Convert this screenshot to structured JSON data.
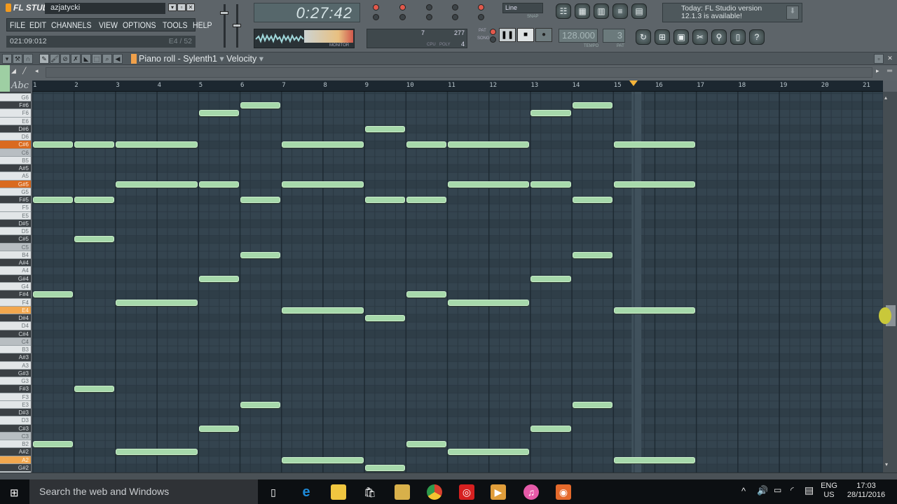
{
  "app": {
    "logo": "FL STUDIO",
    "project": "azjatycki"
  },
  "menu": [
    "FILE",
    "EDIT",
    "CHANNELS",
    "VIEW",
    "OPTIONS",
    "TOOLS",
    "HELP"
  ],
  "hint": {
    "position": "021:09:012",
    "note": "E4 / 52"
  },
  "transport": {
    "time": "0:27:42",
    "tempo": "128.000",
    "tempo_label": "TEMPO",
    "pattern": "3",
    "pattern_label": "PAT",
    "pat_label": "PAT",
    "song_label": "SONG",
    "snap": "Line",
    "snap_label": "SNAP",
    "cpu_label": "CPU",
    "poly_label": "POLY",
    "poly": "4",
    "ram": "277",
    "cpu": "7",
    "monitor_label": "MONITOR"
  },
  "news": {
    "text1": "Today: FL Studio version",
    "text2": "12.1.3 is available!"
  },
  "piano_roll": {
    "title": "Piano roll - Sylenth1",
    "target": "Velocity",
    "abc": "Abc"
  },
  "ruler": [
    "1",
    "2",
    "3",
    "4",
    "5",
    "6",
    "7",
    "8",
    "9",
    "10",
    "11",
    "12",
    "13",
    "14",
    "15",
    "16",
    "17",
    "18",
    "19",
    "20",
    "21"
  ],
  "playhead_bar": 15.5,
  "highlight_keys": {
    "strong": [
      "C#6",
      "G#5"
    ],
    "light": [
      "E4",
      "A2"
    ]
  },
  "note_color": "#a7d9ab",
  "notes": [
    {
      "bar": 1,
      "len": 1,
      "pitches": [
        "C#6",
        "F#5",
        "F#4",
        "B2"
      ]
    },
    {
      "bar": 2,
      "len": 1,
      "pitches": [
        "C#6",
        "F#5",
        "C#5",
        "F#3"
      ]
    },
    {
      "bar": 3,
      "len": 2,
      "pitches": [
        "C#6",
        "G#5",
        "F4",
        "A#2"
      ]
    },
    {
      "bar": 5,
      "len": 1,
      "pitches": [
        "F6",
        "G#5",
        "G#4",
        "C#3"
      ]
    },
    {
      "bar": 6,
      "len": 1,
      "pitches": [
        "F#6",
        "F#5",
        "B4",
        "E3"
      ]
    },
    {
      "bar": 7,
      "len": 2,
      "pitches": [
        "C#6",
        "G#5",
        "E4",
        "A2"
      ]
    },
    {
      "bar": 9,
      "len": 1,
      "pitches": [
        "D#6",
        "F#5",
        "D#4",
        "G#2"
      ]
    },
    {
      "bar": 10,
      "len": 1,
      "pitches": [
        "C#6",
        "F#5",
        "F#4",
        "B2"
      ]
    },
    {
      "bar": 11,
      "len": 2,
      "pitches": [
        "C#6",
        "G#5",
        "F4",
        "A#2"
      ]
    },
    {
      "bar": 13,
      "len": 1,
      "pitches": [
        "F6",
        "G#5",
        "G#4",
        "C#3"
      ]
    },
    {
      "bar": 14,
      "len": 1,
      "pitches": [
        "F#6",
        "F#5",
        "B4",
        "E3"
      ]
    },
    {
      "bar": 15,
      "len": 2,
      "pitches": [
        "C#6",
        "G#5",
        "E4",
        "A2"
      ]
    }
  ],
  "taskbar": {
    "search": "Search the web and Windows",
    "lang1": "ENG",
    "lang2": "US",
    "time": "17:03",
    "date": "28/11/2016",
    "apps": [
      "task-view",
      "edge",
      "file-explorer",
      "store",
      "fl-studio",
      "chrome",
      "app-red",
      "media-player",
      "itunes",
      "app-orange"
    ]
  }
}
